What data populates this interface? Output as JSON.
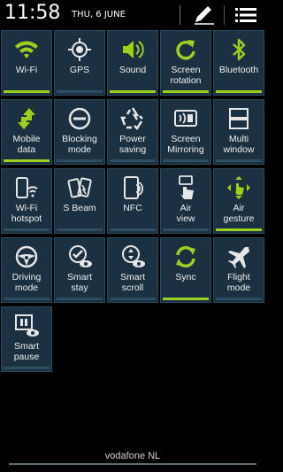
{
  "header": {
    "time": "11:58",
    "date": "THU, 6 JUNE",
    "edit_icon": "pencil-icon",
    "menu_icon": "list-menu-icon"
  },
  "colors": {
    "on": "#9ad11d",
    "off": "#2d4e62",
    "tile": "#1b3040"
  },
  "tiles": [
    {
      "label": "Wi-Fi",
      "icon": "wifi-icon",
      "active": true
    },
    {
      "label": "GPS",
      "icon": "gps-icon",
      "active": false
    },
    {
      "label": "Sound",
      "icon": "sound-icon",
      "active": true
    },
    {
      "label": "Screen\nrotation",
      "icon": "screen-rotation-icon",
      "active": true
    },
    {
      "label": "Bluetooth",
      "icon": "bluetooth-icon",
      "active": true
    },
    {
      "label": "Mobile\ndata",
      "icon": "mobile-data-icon",
      "active": true
    },
    {
      "label": "Blocking\nmode",
      "icon": "blocking-mode-icon",
      "active": false
    },
    {
      "label": "Power\nsaving",
      "icon": "power-saving-icon",
      "active": false
    },
    {
      "label": "Screen\nMirroring",
      "icon": "screen-mirroring-icon",
      "active": false
    },
    {
      "label": "Multi\nwindow",
      "icon": "multi-window-icon",
      "active": false
    },
    {
      "label": "Wi-Fi\nhotspot",
      "icon": "wifi-hotspot-icon",
      "active": false
    },
    {
      "label": "S Beam",
      "icon": "s-beam-icon",
      "active": false
    },
    {
      "label": "NFC",
      "icon": "nfc-icon",
      "active": false
    },
    {
      "label": "Air\nview",
      "icon": "air-view-icon",
      "active": false
    },
    {
      "label": "Air\ngesture",
      "icon": "air-gesture-icon",
      "active": true
    },
    {
      "label": "Driving\nmode",
      "icon": "driving-mode-icon",
      "active": false
    },
    {
      "label": "Smart\nstay",
      "icon": "smart-stay-icon",
      "active": false
    },
    {
      "label": "Smart\nscroll",
      "icon": "smart-scroll-icon",
      "active": false
    },
    {
      "label": "Sync",
      "icon": "sync-icon",
      "active": true
    },
    {
      "label": "Flight\nmode",
      "icon": "flight-mode-icon",
      "active": false
    },
    {
      "label": "Smart\npause",
      "icon": "smart-pause-icon",
      "active": false
    }
  ],
  "carrier": "vodafone NL"
}
